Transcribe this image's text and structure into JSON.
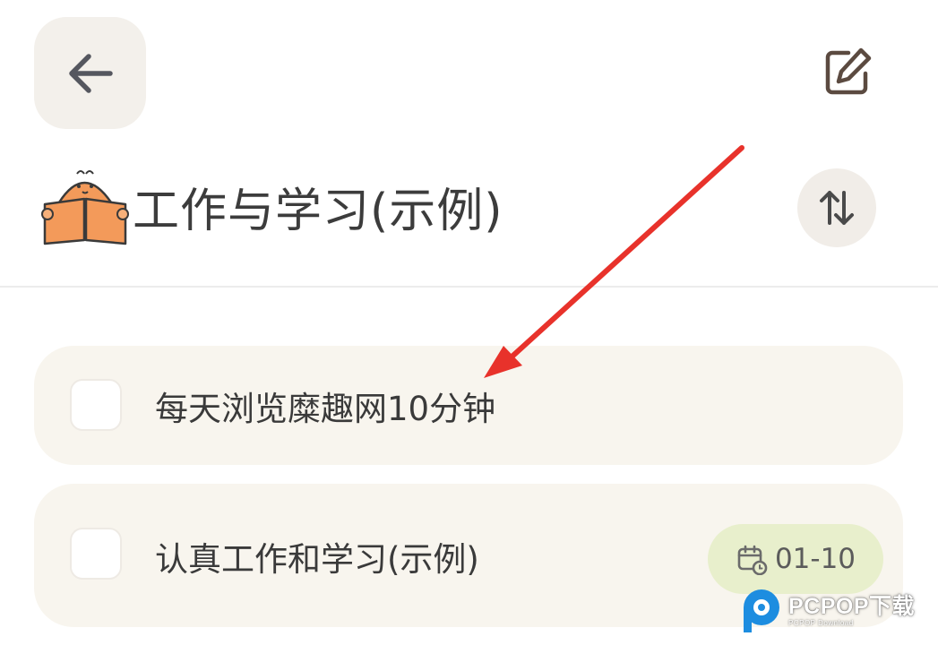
{
  "header": {
    "back_icon": "arrow-left-icon",
    "edit_icon": "edit-note-icon"
  },
  "list": {
    "title": "工作与学习(示例)",
    "mascot_icon": "bear-reading-book",
    "sort_icon": "sort-arrows-icon"
  },
  "tasks": [
    {
      "text": "每天浏览糜趣网10分钟",
      "checked": false
    },
    {
      "text": "认真工作和学习(示例)",
      "checked": false,
      "due": "01-10",
      "due_icon": "calendar-clock-icon"
    }
  ],
  "colors": {
    "card_bg": "#f8f5ee",
    "badge_bg": "#e8efcc",
    "annotation_arrow": "#e8322b",
    "icon_brown": "#5b4a40"
  },
  "watermark": {
    "brand": "PCPOP下载",
    "sub": "PCPOP Download"
  }
}
